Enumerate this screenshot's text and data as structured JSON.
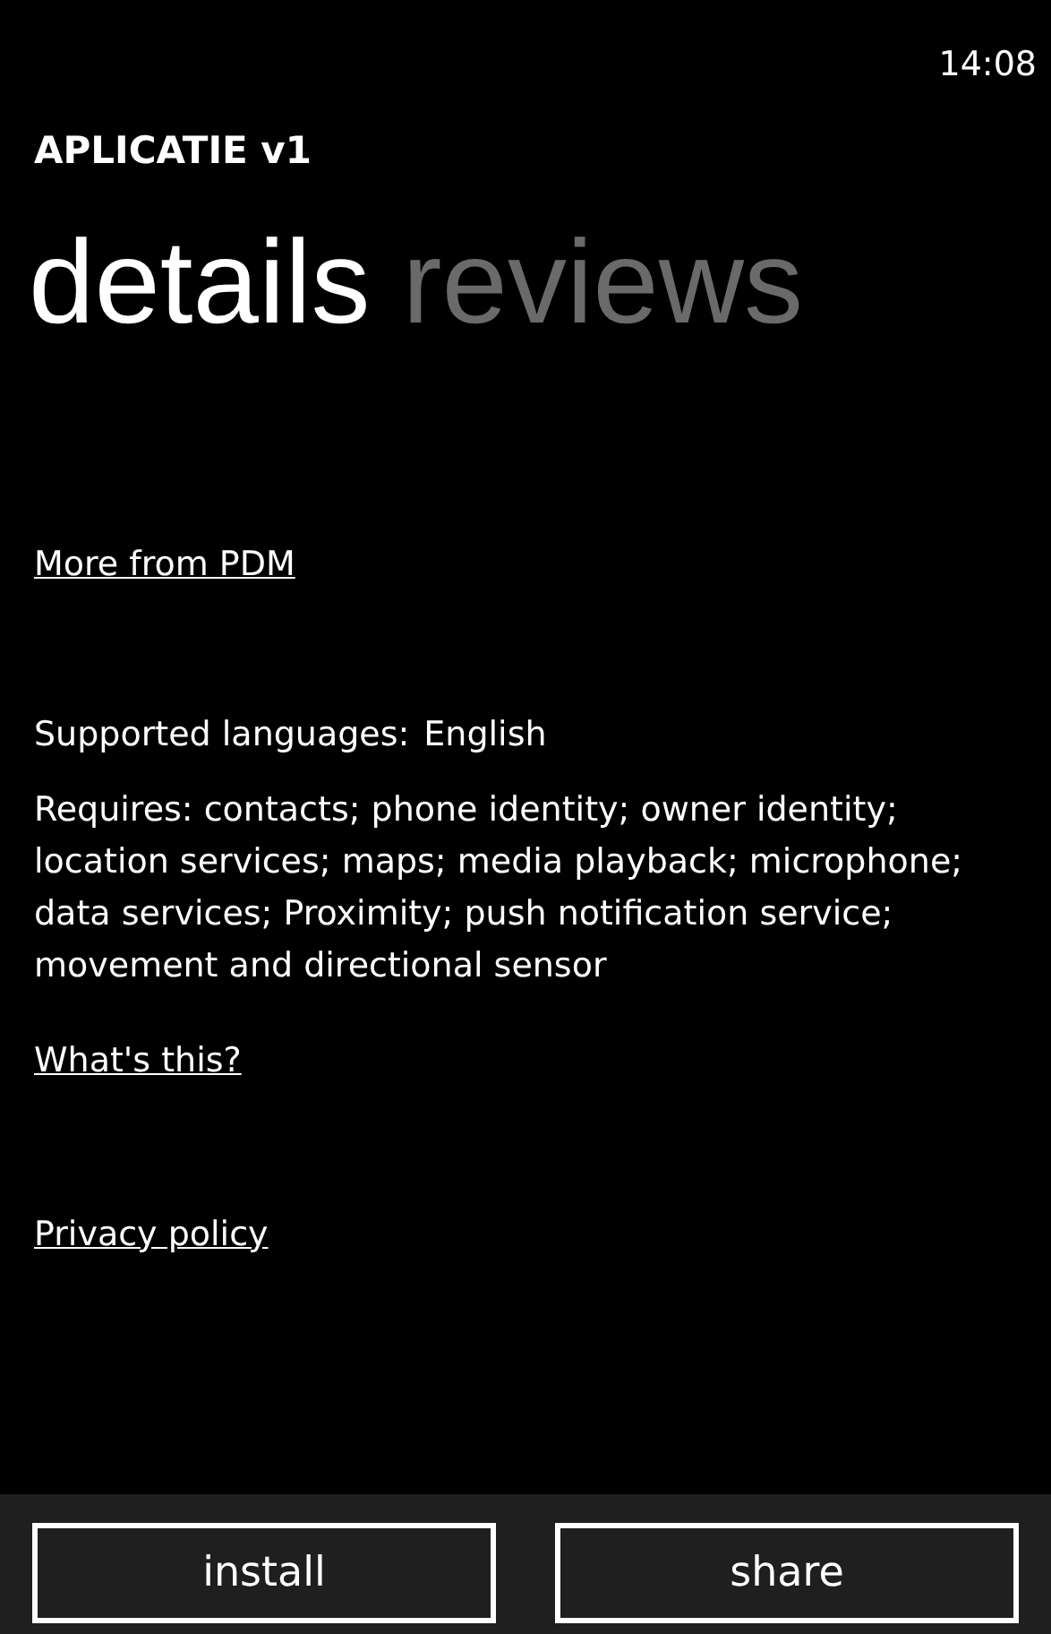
{
  "status_bar": {
    "time": "14:08"
  },
  "app_title": "APLICATIE v1",
  "pivot": [
    {
      "label": "details",
      "selected": true
    },
    {
      "label": "reviews",
      "selected": false
    }
  ],
  "more_link": "More from PDM",
  "supported_languages": {
    "label": "Supported languages:",
    "value": "English"
  },
  "requires": "Requires: contacts; phone identity; owner identity; location services; maps; media playback; microphone; data services; Proximity; push notification service; movement and directional sensor",
  "whats_this_link": "What's this?",
  "privacy_link": "Privacy policy",
  "buttons": [
    "install",
    "share"
  ]
}
